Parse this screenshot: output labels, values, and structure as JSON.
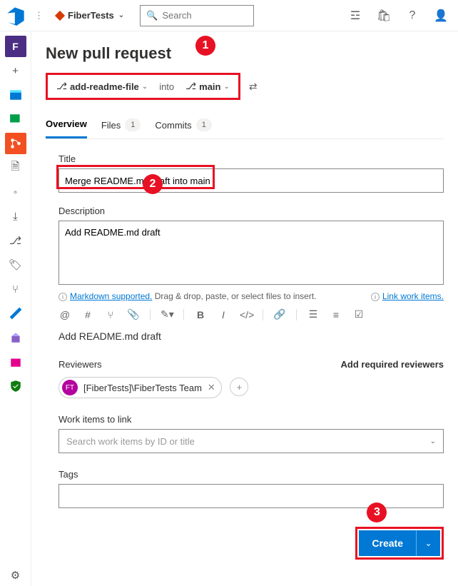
{
  "header": {
    "project_name": "FiberTests",
    "search_placeholder": "Search"
  },
  "page": {
    "title": "New pull request",
    "source_branch": "add-readme-file",
    "into_label": "into",
    "target_branch": "main"
  },
  "tabs": {
    "overview": "Overview",
    "files": "Files",
    "files_count": "1",
    "commits": "Commits",
    "commits_count": "1"
  },
  "form": {
    "title_label": "Title",
    "title_value": "Merge README.md draft into main",
    "desc_label": "Description",
    "desc_value": "Add README.md draft",
    "markdown_link": "Markdown supported.",
    "markdown_hint": "Drag & drop, paste, or select files to insert.",
    "link_workitems": "Link work items.",
    "preview_text": "Add README.md draft",
    "reviewers_label": "Reviewers",
    "add_reviewers": "Add required reviewers",
    "reviewer_pill": "[FiberTests]\\FiberTests Team",
    "reviewer_initials": "FT",
    "workitems_label": "Work items to link",
    "workitems_placeholder": "Search work items by ID or title",
    "tags_label": "Tags",
    "create_button": "Create"
  },
  "callouts": {
    "c1": "1",
    "c2": "2",
    "c3": "3"
  }
}
